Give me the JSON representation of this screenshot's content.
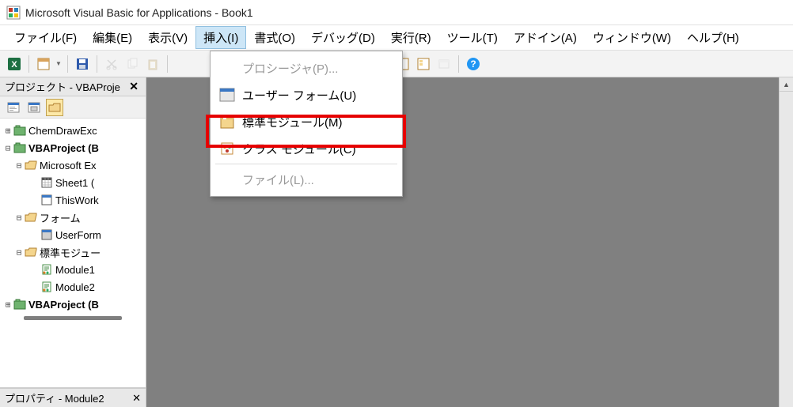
{
  "window": {
    "title": "Microsoft Visual Basic for Applications - Book1"
  },
  "menu": {
    "file": "ファイル(F)",
    "edit": "編集(E)",
    "view": "表示(V)",
    "insert": "挿入(I)",
    "format": "書式(O)",
    "debug": "デバッグ(D)",
    "run": "実行(R)",
    "tools": "ツール(T)",
    "addins": "アドイン(A)",
    "window": "ウィンドウ(W)",
    "help": "ヘルプ(H)"
  },
  "dropdown": {
    "procedure": "プロシージャ(P)...",
    "userform": "ユーザー フォーム(U)",
    "module": "標準モジュール(M)",
    "classmodule": "クラス モジュール(C)",
    "file": "ファイル(L)..."
  },
  "panels": {
    "project_title": "プロジェクト - VBAProje",
    "properties_title": "プロパティ - Module2"
  },
  "tree": {
    "n0": "ChemDrawExc",
    "n1": "VBAProject (B",
    "n2": "Microsoft Ex",
    "n3": "Sheet1 (",
    "n4": "ThisWork",
    "n5": "フォーム",
    "n6": "UserForm",
    "n7": "標準モジュー",
    "n8": "Module1",
    "n9": "Module2",
    "n10": "VBAProject (B"
  }
}
